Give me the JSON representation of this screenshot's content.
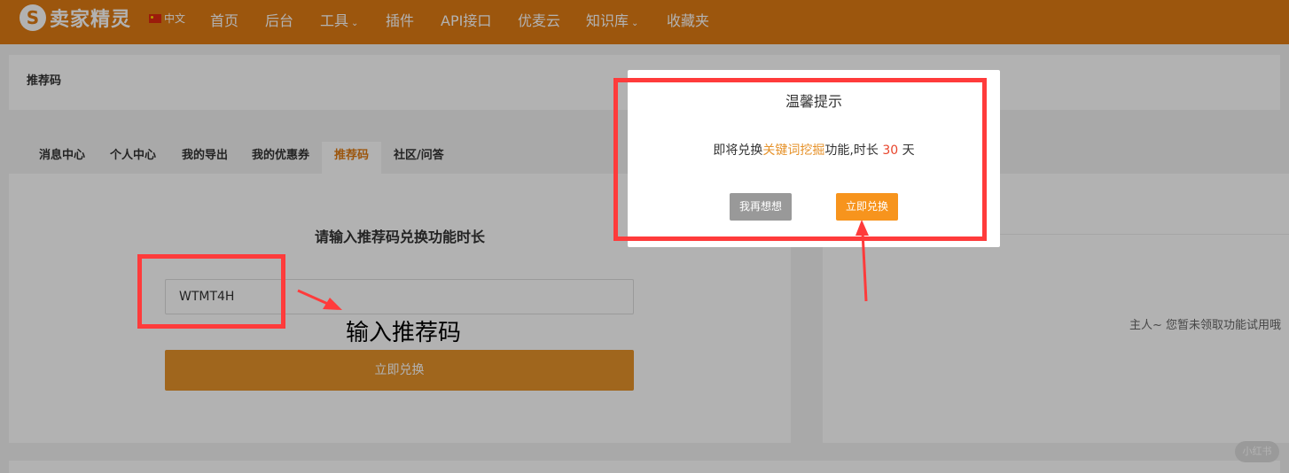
{
  "nav": {
    "logo_mark": "S",
    "logo_text": "卖家精灵",
    "lang": "中文",
    "items": [
      {
        "label": "首页"
      },
      {
        "label": "后台"
      },
      {
        "label": "工具"
      },
      {
        "label": "插件"
      },
      {
        "label": "API接口"
      },
      {
        "label": "优麦云"
      },
      {
        "label": "知识库"
      },
      {
        "label": "收藏夹"
      }
    ],
    "dropdown_glyph": "⌄"
  },
  "breadcrumb": "推荐码",
  "tabs": [
    {
      "label": "消息中心"
    },
    {
      "label": "个人中心"
    },
    {
      "label": "我的导出"
    },
    {
      "label": "我的优惠券"
    },
    {
      "label": "推荐码",
      "active": true
    },
    {
      "label": "社区/问答"
    }
  ],
  "form": {
    "title": "请输入推荐码兑换功能时长",
    "code_value": "WTMT4H",
    "submit_label": "立即兑换"
  },
  "right_panel": {
    "empty_text": "主人~ 您暂未领取功能试用哦"
  },
  "annotation": {
    "text": "输入推荐码",
    "color": "#ff3b3b"
  },
  "modal": {
    "title": "温馨提示",
    "msg_prefix": "即将兑换",
    "msg_feature": "关键词挖掘",
    "msg_mid": "功能,时长",
    "msg_days": "30",
    "msg_suffix": "天",
    "cancel_label": "我再想想",
    "confirm_label": "立即兑换"
  },
  "watermark": "小红书",
  "colors": {
    "brand": "#e07b13",
    "button": "#e6922a",
    "highlight_number": "#e8452c"
  }
}
